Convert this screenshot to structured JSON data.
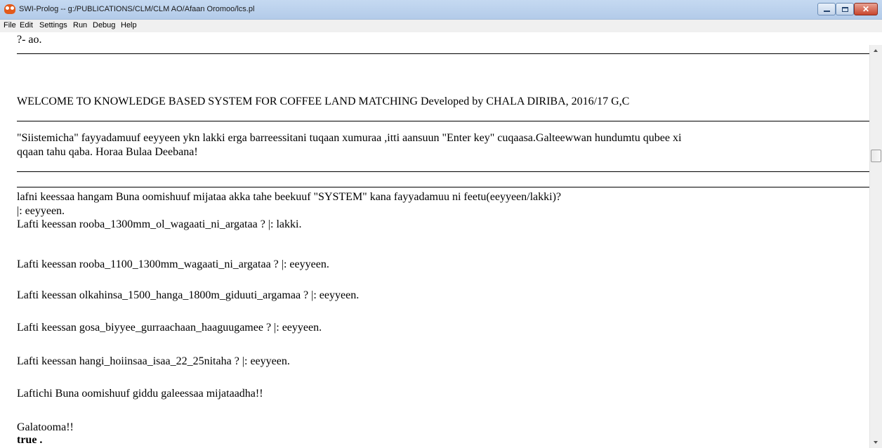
{
  "window": {
    "title": "SWI-Prolog -- g:/PUBLICATIONS/CLM/CLM AO/Afaan Oromoo/lcs.pl",
    "controls": {
      "close_glyph": "✕"
    }
  },
  "menubar": {
    "items": [
      "File",
      "Edit",
      "Settings",
      "Run",
      "Debug",
      "Help"
    ]
  },
  "console": {
    "lines": [
      "?- ao.",
      "WELCOME TO KNOWLEDGE BASED SYSTEM FOR COFFEE LAND MATCHING Developed by CHALA DIRIBA, 2016/17 G,C",
      "\"Siistemicha\" fayyadamuuf eeyyeen ykn lakki erga barreessitani tuqaan xumuraa ,itti aansuun \"Enter key\"  cuqaasa.Galteewwan hundumtu qubee xi",
      "qqaan tahu qaba. Horaa Bulaa Deebana!",
      "lafni keessaa hangam Buna oomishuuf mijataa akka tahe beekuuf \"SYSTEM\" kana fayyadamuu ni feetu(eeyyeen/lakki)?",
      "|: eeyyeen.",
      "Lafti keessan  rooba_1300mm_ol_wagaati_ni_argataa ? |: lakki.",
      "Lafti keessan  rooba_1100_1300mm_wagaati_ni_argataa ? |: eeyyeen.",
      "Lafti keessan  olkahinsa_1500_hanga_1800m_giduuti_argamaa ? |: eeyyeen.",
      "Lafti keessan  gosa_biyyee_gurraachaan_haaguugamee ? |: eeyyeen.",
      "Lafti keessan  hangi_hoiinsaa_isaa_22_25nitaha ? |: eeyyeen.",
      "Laftichi Buna oomishuuf giddu galeessaa mijataadha!!",
      "Galatooma!!",
      "true ."
    ]
  },
  "colors": {
    "titlebar": "#c5d9f1",
    "menubar": "#f0f0f0",
    "close_button": "#c8452d"
  }
}
